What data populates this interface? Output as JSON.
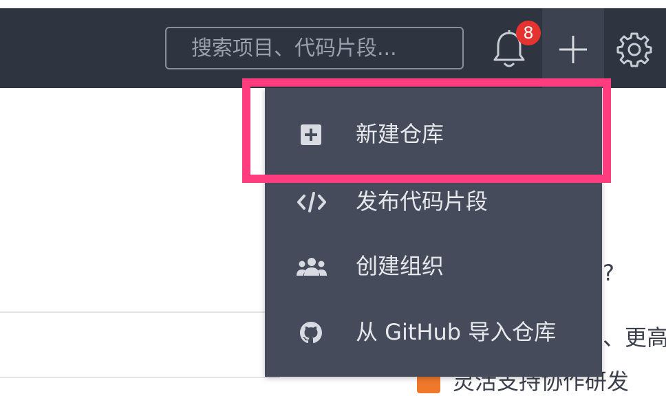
{
  "header": {
    "search_placeholder": "搜索项目、代码片段...",
    "notification_count": "8"
  },
  "menu": {
    "items": [
      {
        "label": "新建仓库",
        "icon": "plus-square-icon"
      },
      {
        "label": "发布代码片段",
        "icon": "code-icon"
      },
      {
        "label": "创建组织",
        "icon": "users-icon"
      },
      {
        "label": "从 GitHub 导入仓库",
        "icon": "github-icon"
      }
    ]
  },
  "background": {
    "text_question": "?",
    "text_more": "、更高",
    "text_bottom": "灵活支持协作研发"
  },
  "colors": {
    "header_bg": "#2f3441",
    "menu_bg": "#454b5a",
    "highlight": "#ff3c7e",
    "badge": "#e5332f"
  }
}
